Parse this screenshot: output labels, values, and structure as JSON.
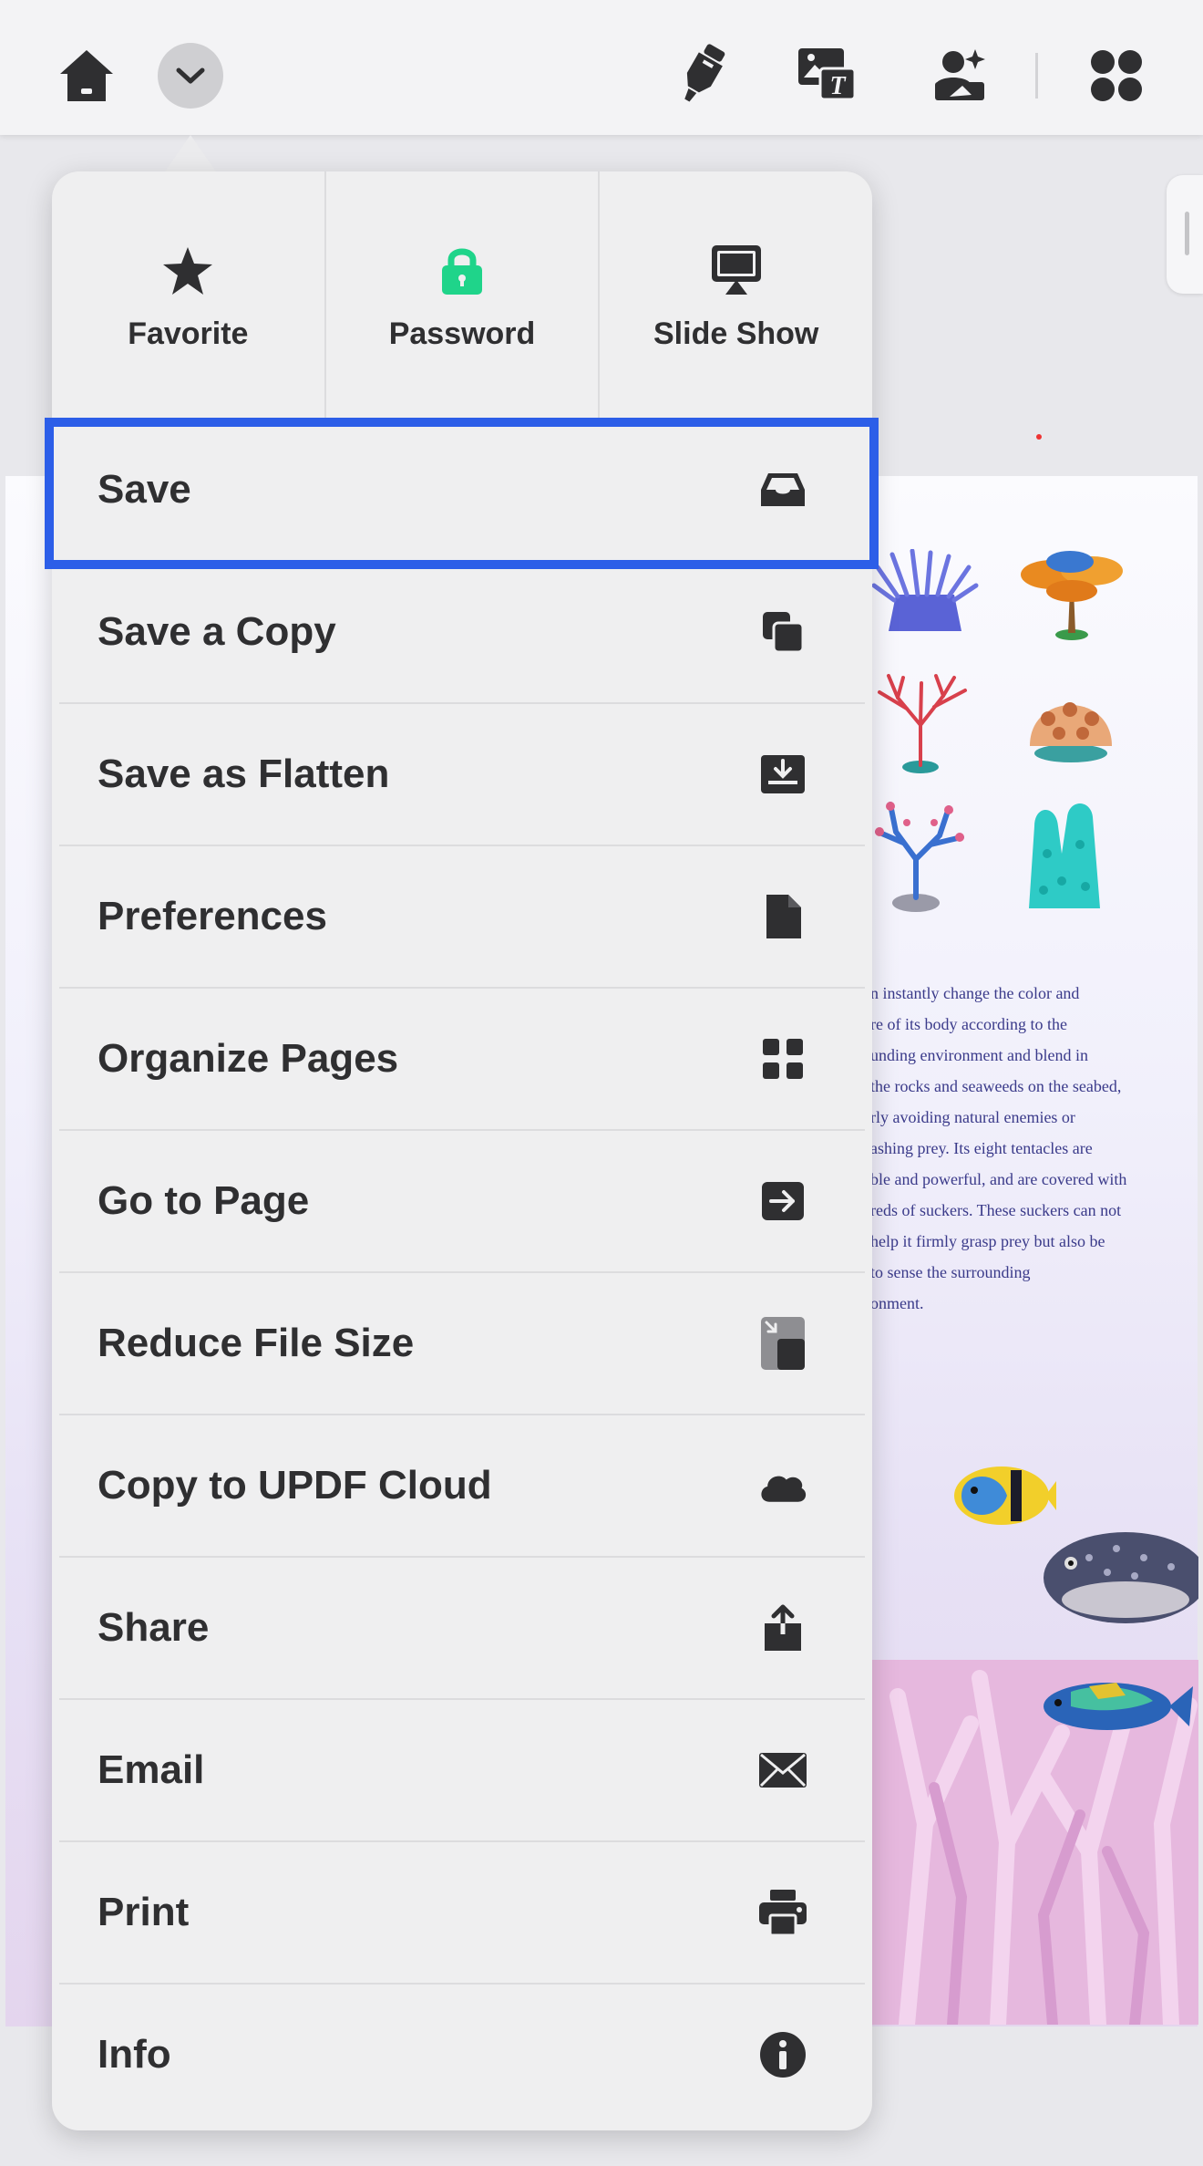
{
  "toolbar": {
    "icons": [
      "home-icon",
      "chevron-down-icon",
      "marker-icon",
      "image-text-icon",
      "photo-edit-icon",
      "app-grid-icon"
    ]
  },
  "menu": {
    "quick_actions": [
      {
        "label": "Favorite",
        "icon": "star-icon",
        "icon_color": "#2f2f31"
      },
      {
        "label": "Password",
        "icon": "lock-icon",
        "icon_color": "#1fd48a"
      },
      {
        "label": "Slide Show",
        "icon": "slideshow-icon",
        "icon_color": "#2f2f31"
      }
    ],
    "items": [
      {
        "label": "Save",
        "icon": "inbox-tray-icon",
        "highlighted": true
      },
      {
        "label": "Save a Copy",
        "icon": "copy-icon"
      },
      {
        "label": "Save as Flatten",
        "icon": "download-tray-icon"
      },
      {
        "label": "Preferences",
        "icon": "document-icon"
      },
      {
        "label": "Organize Pages",
        "icon": "four-squares-icon"
      },
      {
        "label": "Go to Page",
        "icon": "arrow-box-icon"
      },
      {
        "label": "Reduce File Size",
        "icon": "compress-file-icon"
      },
      {
        "label": "Copy to UPDF Cloud",
        "icon": "cloud-icon"
      },
      {
        "label": "Share",
        "icon": "share-icon"
      },
      {
        "label": "Email",
        "icon": "envelope-icon"
      },
      {
        "label": "Print",
        "icon": "printer-icon"
      },
      {
        "label": "Info",
        "icon": "info-icon"
      }
    ]
  },
  "document": {
    "paragraph_lines": [
      "n instantly change the color and",
      "re of its body according to the",
      "unding environment and blend in",
      "the rocks and seaweeds on the seabed,",
      "rly avoiding natural enemies or",
      "ashing prey. Its eight tentacles are",
      "ble and powerful, and are covered with",
      "reds of suckers. These suckers can not",
      "help it firmly grasp prey but also be",
      "to sense the surrounding",
      "onment."
    ]
  },
  "colors": {
    "highlight_border": "#2c5ee8",
    "menu_background": "#efeff0",
    "lock_green": "#1fd48a",
    "doc_text": "#3a3a8a"
  }
}
